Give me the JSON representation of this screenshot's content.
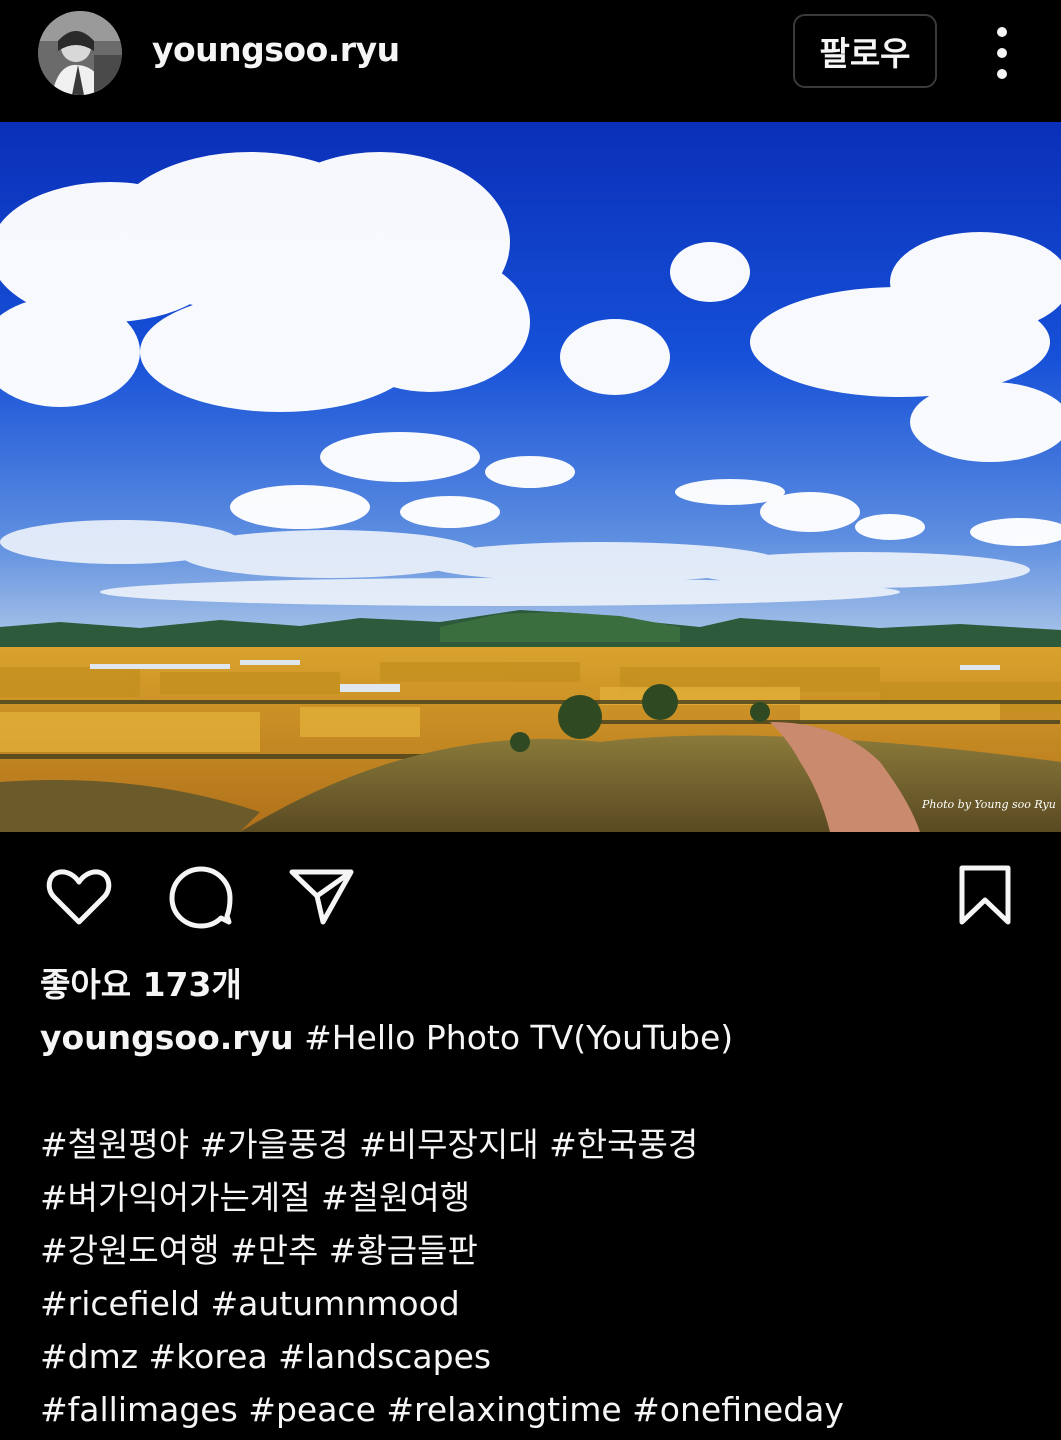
{
  "post": {
    "username": "youngsoo.ryu",
    "follow_label": "팔로우",
    "likes_text": "좋아요 173개",
    "caption_first": "#Hello Photo TV(YouTube)",
    "hashtag_lines": [
      "#철원평야  #가을풍경 #비무장지대 #한국풍경",
      "#벼가익어가는계절 #철원여행",
      "#강원도여행 #만추 #황금들판",
      "#ricefield #autumnmood",
      "#dmz #korea #landscapes",
      "#fallimages #peace #relaxingtime #onefineday"
    ],
    "photo_watermark": "Photo by Young soo Ryu"
  },
  "icons": {
    "more": "more-vertical-icon",
    "like": "heart-icon",
    "comment": "comment-bubble-icon",
    "share": "send-paper-plane-icon",
    "save": "bookmark-icon"
  },
  "colors": {
    "background": "#000000",
    "text": "#f5f5f5",
    "button_border": "#3a3a3a"
  }
}
